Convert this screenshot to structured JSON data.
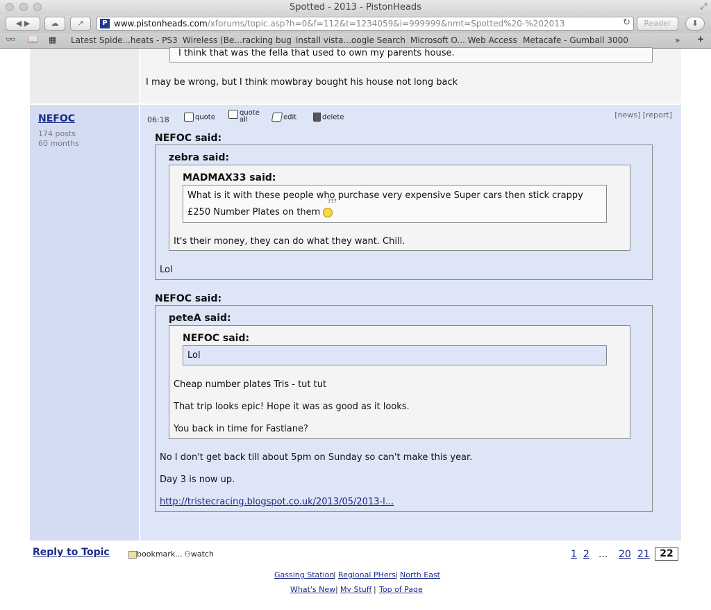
{
  "window": {
    "title": "Spotted - 2013 - PistonHeads"
  },
  "toolbar": {
    "url_domain": "www.pistonheads.com",
    "url_path": "/xforums/topic.asp?h=0&f=112&t=1234059&i=999999&nmt=Spotted%20-%202013",
    "reader_label": "Reader",
    "favicon_letter": "P"
  },
  "bookmarks": [
    "Latest Spide...heats - PS3",
    "Wireless (Be...racking bug",
    "install vista...oogle Search",
    "Microsoft O... Web Access",
    "Metacafe - Gumball 3000"
  ],
  "previous_post": {
    "quote_text": "I think that was the fella that used to own my parents house.",
    "text": "I may be wrong, but I think mowbray bought his house not long back"
  },
  "post": {
    "author": "NEFOC",
    "posts": "174 posts",
    "months": "60 months",
    "time": "06:18",
    "actions": {
      "quote": "quote",
      "quote_all_1": "quote",
      "quote_all_2": "all",
      "edit": "edit",
      "delete": "delete"
    },
    "news_report": "[news] [report]",
    "q1": {
      "said": "NEFOC said:",
      "q2": {
        "said": "zebra said:",
        "q3": {
          "said": "MADMAX33 said:",
          "line1": "What is it with these people who purchase very expensive Super cars then stick crappy",
          "line2": "£250 Number Plates on them",
          "emoticon_marks": "???"
        },
        "reply": "It's their money, they can do what they want. Chill."
      },
      "reply": "Lol"
    },
    "q4": {
      "said": "NEFOC said:",
      "q5": {
        "said": "peteA said:",
        "q6": {
          "said": "NEFOC said:",
          "text": "Lol"
        },
        "p1": "Cheap number plates Tris - tut tut",
        "p2": "That trip looks epic! Hope it was as good as it looks.",
        "p3": "You back in time for Fastlane?"
      }
    },
    "body1": "No I don't get back till about 5pm on Sunday so can't make this year.",
    "body2": "Day 3 is now up.",
    "link": "http://tristecracing.blogspot.co.uk/2013/05/2013-l..."
  },
  "footer": {
    "reply": "Reply to Topic",
    "bookmark": "bookmark...",
    "watch": "watch",
    "pages": [
      "1",
      "2",
      "...",
      "20",
      "21"
    ],
    "current_page": "22",
    "links_row1": [
      "Gassing Station",
      "Regional PHers",
      "North East"
    ],
    "links_row2": [
      "What's New",
      "My Stuff",
      "Top of Page"
    ]
  }
}
